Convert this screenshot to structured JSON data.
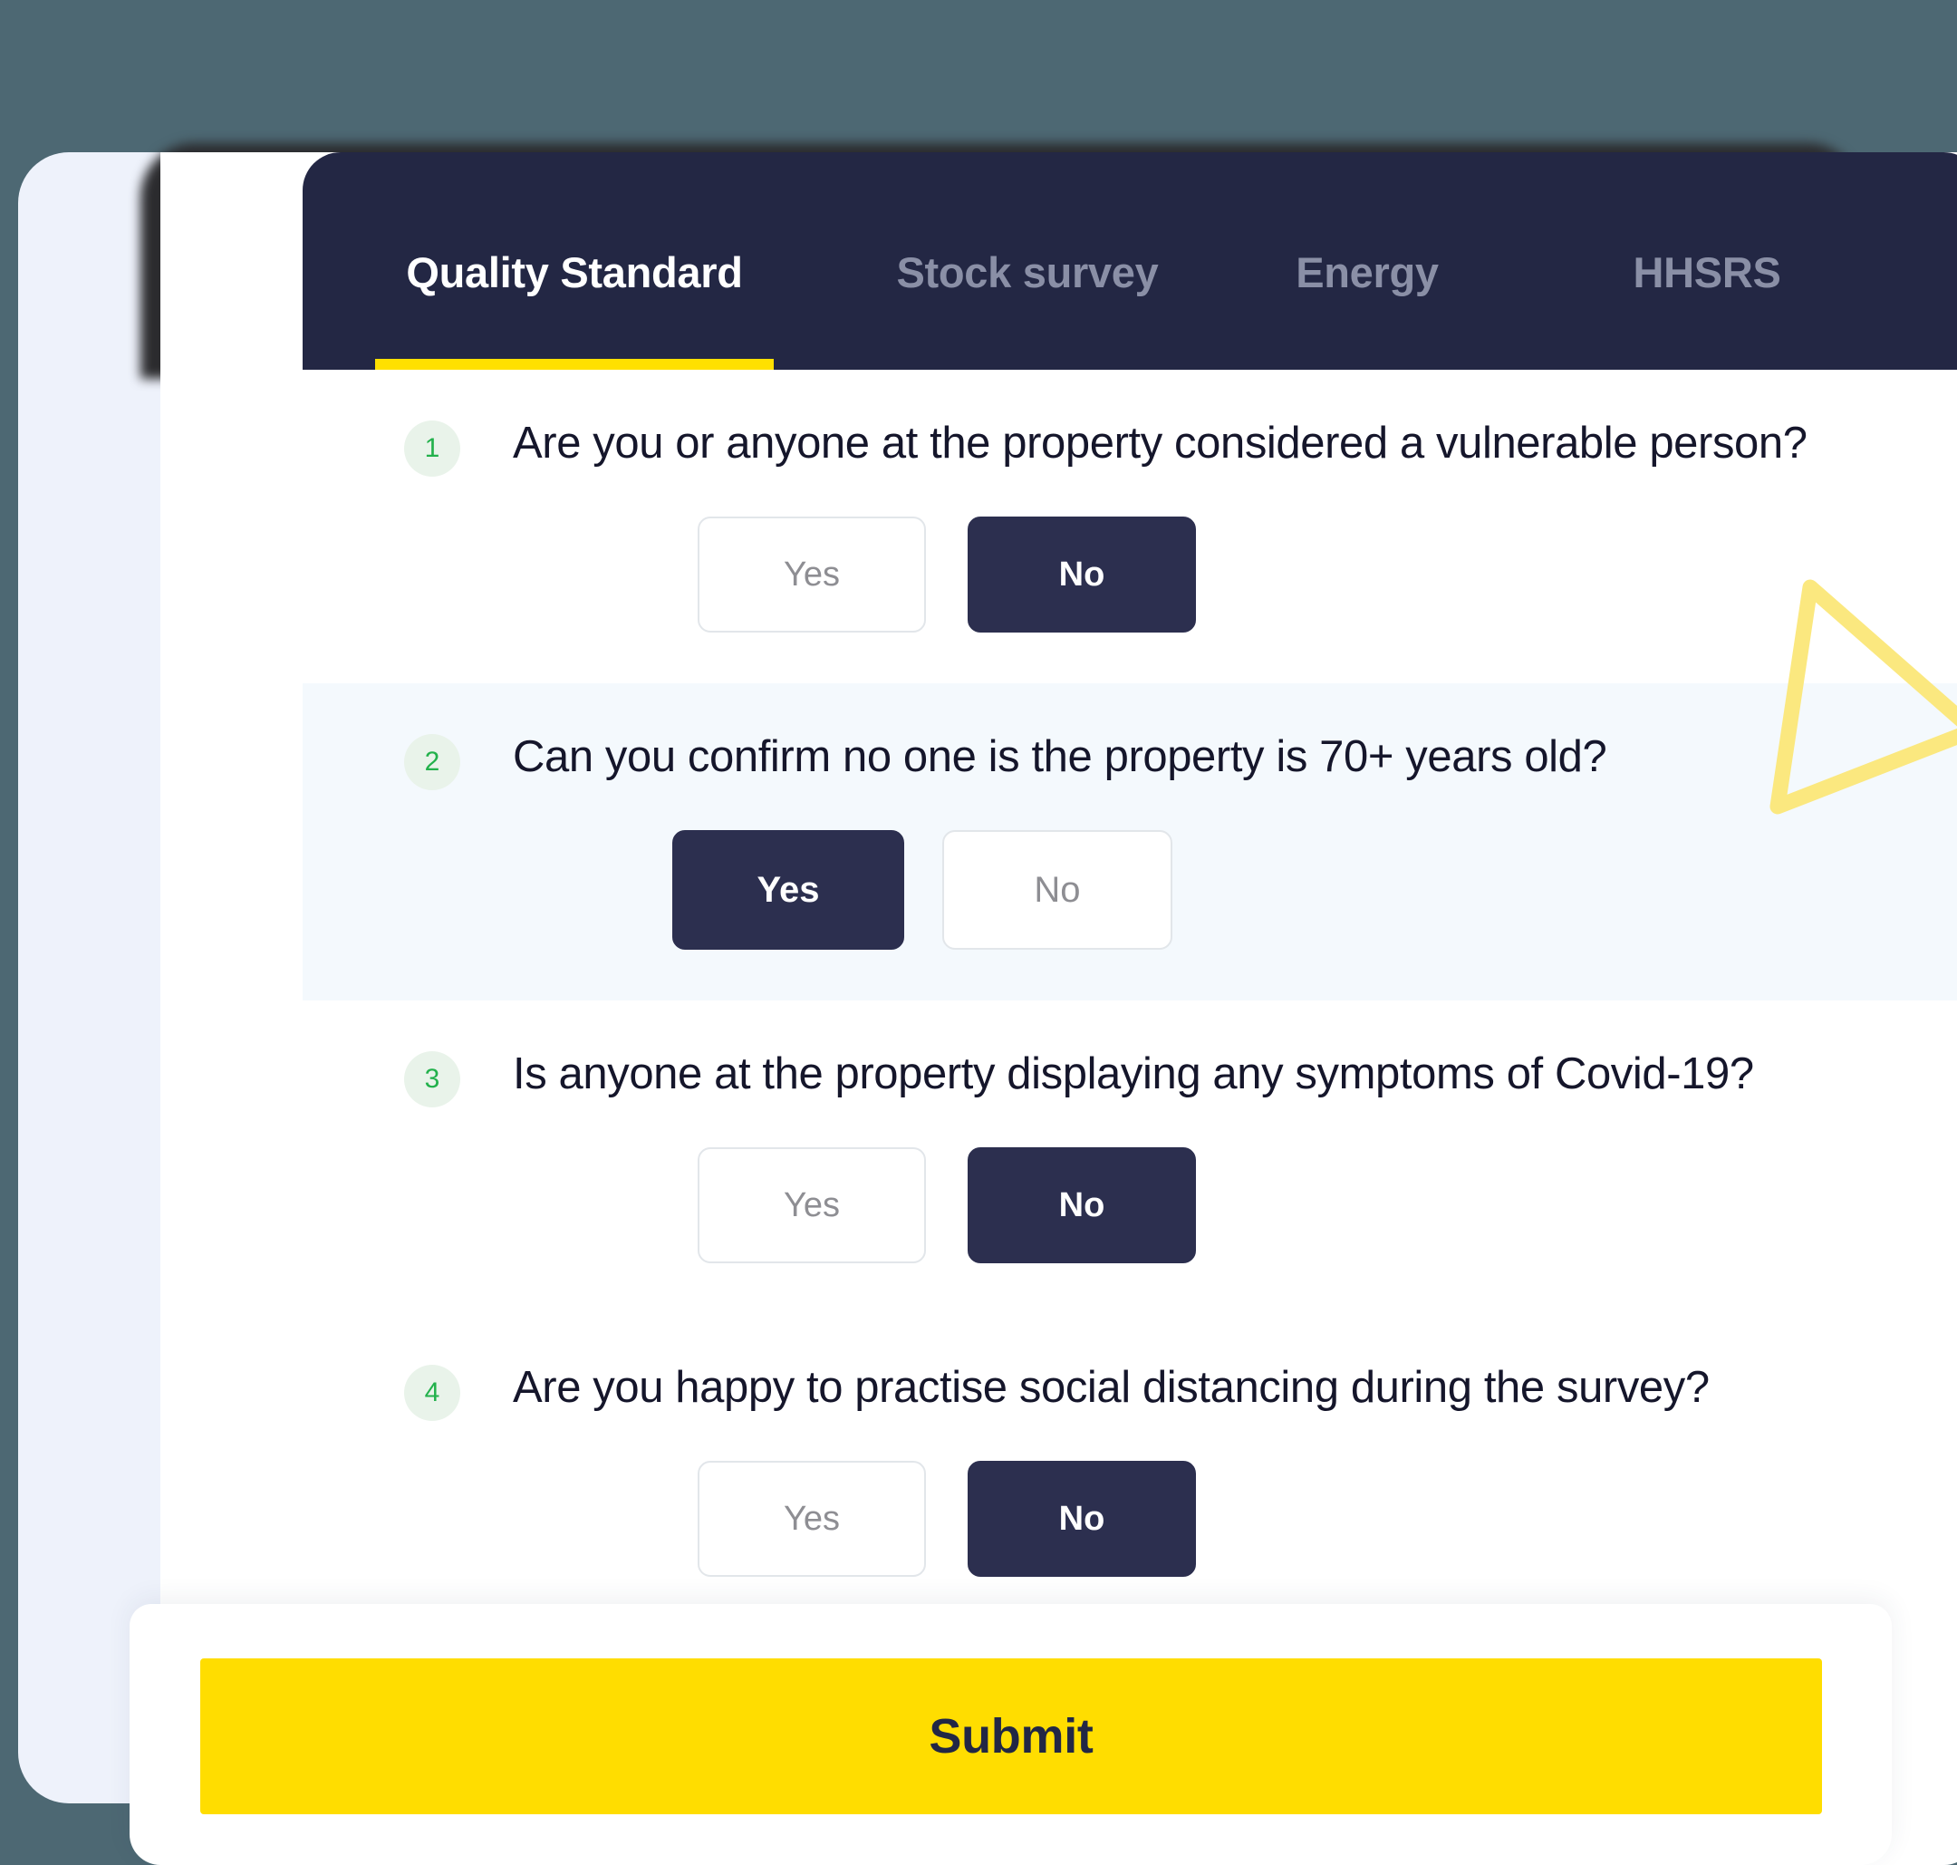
{
  "header": {
    "tabs": [
      {
        "label": "Quality Standard",
        "active": true
      },
      {
        "label": "Stock survey",
        "active": false
      },
      {
        "label": "Energy",
        "active": false
      },
      {
        "label": "HHSRS",
        "active": false
      }
    ],
    "active_tab": "Quality Standard",
    "bg_color": "#232744",
    "active_underline_color": "#FFE000",
    "inactive_tab_color": "#8A8FA6"
  },
  "questions": [
    {
      "number": "1",
      "text": "Are you or anyone at the property considered a vulnerable person?",
      "options": [
        {
          "label": "Yes",
          "selected": false
        },
        {
          "label": "No",
          "selected": true
        }
      ],
      "shaded": false
    },
    {
      "number": "2",
      "text": "Can you confirm no one is the property is 70+ years old?",
      "options": [
        {
          "label": "Yes",
          "selected": true
        },
        {
          "label": "No",
          "selected": false
        }
      ],
      "shaded": true
    },
    {
      "number": "3",
      "text": "Is anyone at the property displaying any symptoms of Covid-19?",
      "options": [
        {
          "label": "Yes",
          "selected": false
        },
        {
          "label": "No",
          "selected": true
        }
      ],
      "shaded": false
    },
    {
      "number": "4",
      "text": "Are you happy to practise social distancing during the survey?",
      "options": [
        {
          "label": "Yes",
          "selected": false
        },
        {
          "label": "No",
          "selected": true
        }
      ],
      "shaded": false
    }
  ],
  "footer": {
    "submit_label": "Submit",
    "submit_bg": "#FFDD00",
    "submit_text_color": "#222745"
  },
  "decoration": {
    "triangle_color": "#FBE87F",
    "icon": "triangle-outline-icon"
  },
  "theme": {
    "page_background": "#4D6873",
    "panel_background": "#EEF2FB",
    "card_background": "#FFFFFF",
    "shaded_row_background": "#F4F9FD",
    "badge_background": "#E9F3EA",
    "badge_text": "#23B14C",
    "selected_option_background": "#2C2F4F",
    "question_text_color": "#15162B"
  }
}
